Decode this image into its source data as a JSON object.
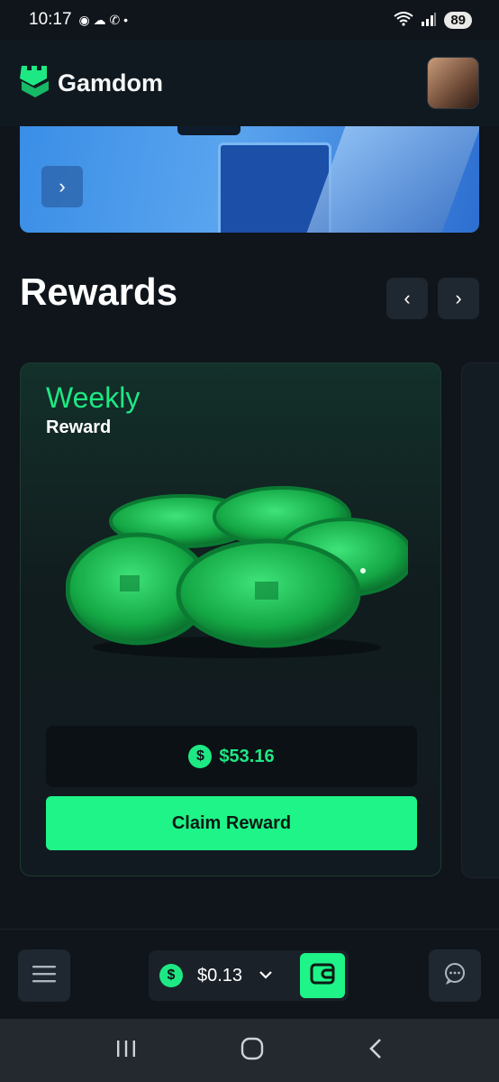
{
  "status_bar": {
    "time": "10:17",
    "battery": "89"
  },
  "header": {
    "brand": "Gamdom"
  },
  "rewards": {
    "title": "Rewards",
    "card": {
      "period": "Weekly",
      "subtitle": "Reward",
      "amount": "$53.16",
      "currency_symbol": "$",
      "claim_label": "Claim Reward"
    }
  },
  "bottom_bar": {
    "currency_symbol": "$",
    "balance": "$0.13"
  },
  "colors": {
    "accent": "#1ef488",
    "accent_text": "#1ee884",
    "background": "#0f151b",
    "surface": "#1f2730"
  },
  "icons": {
    "brand_logo": "gamdom-castle-icon",
    "banner_next": "chevron-right-icon",
    "prev": "chevron-left-icon",
    "next": "chevron-right-icon",
    "menu": "hamburger-icon",
    "wallet": "wallet-icon",
    "chat": "chat-bubble-icon",
    "currency_dropdown": "chevron-down-icon"
  }
}
